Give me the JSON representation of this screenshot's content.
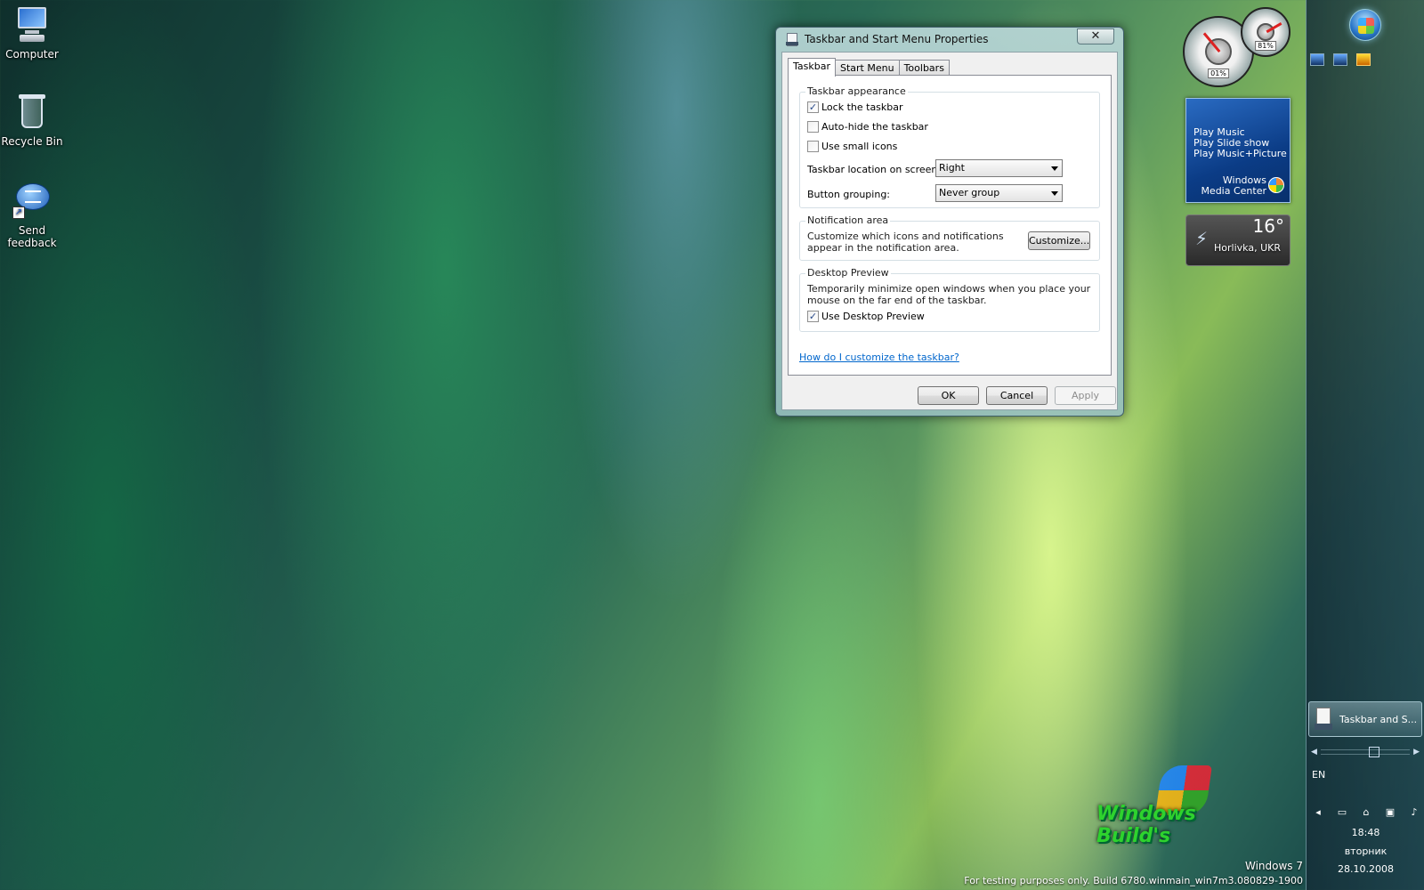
{
  "desktop": {
    "icons": [
      {
        "label": "Computer"
      },
      {
        "label": "Recycle Bin"
      },
      {
        "label": "Send feedback"
      }
    ],
    "watermark": {
      "title": "Windows 7",
      "build": "For testing purposes only. Build 6780.winmain_win7m3.080829-1900",
      "logo_text": "Windows Build's"
    }
  },
  "dialog": {
    "title": "Taskbar and Start Menu Properties",
    "close_label": "✕",
    "tabs": [
      {
        "label": "Taskbar",
        "active": true
      },
      {
        "label": "Start Menu",
        "active": false
      },
      {
        "label": "Toolbars",
        "active": false
      }
    ],
    "appearance": {
      "title": "Taskbar appearance",
      "lock_label": "Lock the taskbar",
      "lock_checked": true,
      "autohide_label": "Auto-hide the taskbar",
      "autohide_checked": false,
      "small_icons_label": "Use small icons",
      "small_icons_checked": false,
      "location_label": "Taskbar location on screen:",
      "location_value": "Right",
      "grouping_label": "Button grouping:",
      "grouping_value": "Never group"
    },
    "notification": {
      "title": "Notification area",
      "description": "Customize which icons and notifications appear in the notification area.",
      "customize_label": "Customize..."
    },
    "preview": {
      "title": "Desktop Preview",
      "description": "Temporarily minimize open windows when you place your mouse on the far end of the taskbar.",
      "use_label": "Use Desktop Preview",
      "use_checked": true
    },
    "help_link": "How do I customize the taskbar?",
    "buttons": {
      "ok": "OK",
      "cancel": "Cancel",
      "apply": "Apply"
    }
  },
  "gadgets": {
    "cpu": {
      "cpu_readout": "01%",
      "mem_readout": "81%"
    },
    "media_center": {
      "items": [
        "Play Music",
        "Play Slide show",
        "Play Music+Picture"
      ],
      "brand_line1": "Windows",
      "brand_line2": "Media Center"
    },
    "weather": {
      "temperature": "16°",
      "city": "Horlivka, UKR"
    }
  },
  "taskbar": {
    "task_button_label": "Taskbar and S...",
    "language": "EN",
    "time": "18:48",
    "day": "вторник",
    "date": "28.10.2008"
  }
}
